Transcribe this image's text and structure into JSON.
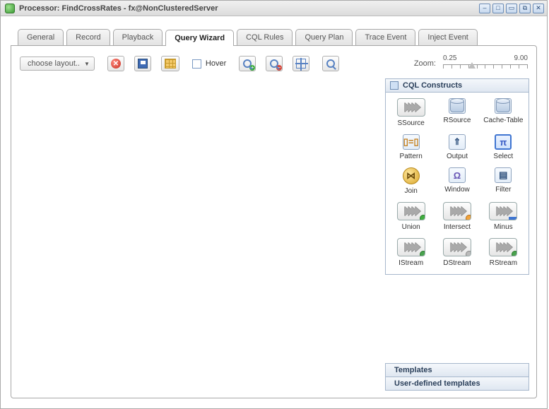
{
  "window": {
    "title": "Processor: FindCrossRates - fx@NonClusteredServer"
  },
  "tabs": [
    {
      "label": "General"
    },
    {
      "label": "Record"
    },
    {
      "label": "Playback"
    },
    {
      "label": "Query Wizard",
      "active": true
    },
    {
      "label": "CQL Rules"
    },
    {
      "label": "Query Plan"
    },
    {
      "label": "Trace Event"
    },
    {
      "label": "Inject Event"
    }
  ],
  "toolbar": {
    "layout_placeholder": "choose layout..",
    "hover_label": "Hover",
    "hover_checked": false,
    "zoom_label": "Zoom:",
    "zoom_min": "0.25",
    "zoom_max": "9.00"
  },
  "palette": {
    "constructs_title": "CQL Constructs",
    "templates_title": "Templates",
    "user_templates_title": "User-defined templates",
    "items": [
      {
        "id": "ssource",
        "label": "SSource",
        "kind": "chev"
      },
      {
        "id": "rsource",
        "label": "RSource",
        "kind": "db-arrow"
      },
      {
        "id": "cachetable",
        "label": "Cache-Table",
        "kind": "db"
      },
      {
        "id": "pattern",
        "label": "Pattern",
        "kind": "pattern"
      },
      {
        "id": "output",
        "label": "Output",
        "kind": "output"
      },
      {
        "id": "select",
        "label": "Select",
        "kind": "pi",
        "selected": true
      },
      {
        "id": "join",
        "label": "Join",
        "kind": "join"
      },
      {
        "id": "window",
        "label": "Window",
        "kind": "omega"
      },
      {
        "id": "filter",
        "label": "Filter",
        "kind": "filter"
      },
      {
        "id": "union",
        "label": "Union",
        "kind": "chev",
        "badge": "green"
      },
      {
        "id": "intersect",
        "label": "Intersect",
        "kind": "chev",
        "badge": "orange"
      },
      {
        "id": "minus",
        "label": "Minus",
        "kind": "chev",
        "badge": "bluebar"
      },
      {
        "id": "istream",
        "label": "IStream",
        "kind": "chev",
        "badge": "dnarrow"
      },
      {
        "id": "dstream",
        "label": "DStream",
        "kind": "chev",
        "badge": "trash"
      },
      {
        "id": "rstream",
        "label": "RStream",
        "kind": "chev",
        "badge": "uparrow"
      }
    ]
  }
}
